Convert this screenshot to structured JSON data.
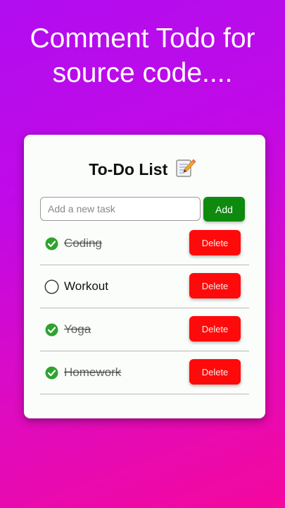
{
  "headline": {
    "line1": "Comment Todo for",
    "line2": "source code...."
  },
  "card": {
    "title": "To-Do List",
    "title_icon": "memo-icon",
    "input": {
      "placeholder": "Add a new task",
      "value": ""
    },
    "add_label": "Add",
    "tasks": [
      {
        "label": "Coding",
        "done": true,
        "delete_label": "Delete"
      },
      {
        "label": "Workout",
        "done": false,
        "delete_label": "Delete"
      },
      {
        "label": "Yoga",
        "done": true,
        "delete_label": "Delete"
      },
      {
        "label": "Homework",
        "done": true,
        "delete_label": "Delete"
      }
    ]
  },
  "colors": {
    "background_start": "#b10df0",
    "background_end": "#f4089d",
    "add_button": "#0e8a0e",
    "delete_button": "#ff0a0a",
    "check_done": "#2fa32f"
  },
  "icons": {
    "done": "check-circle-icon",
    "pending": "empty-circle-icon"
  }
}
